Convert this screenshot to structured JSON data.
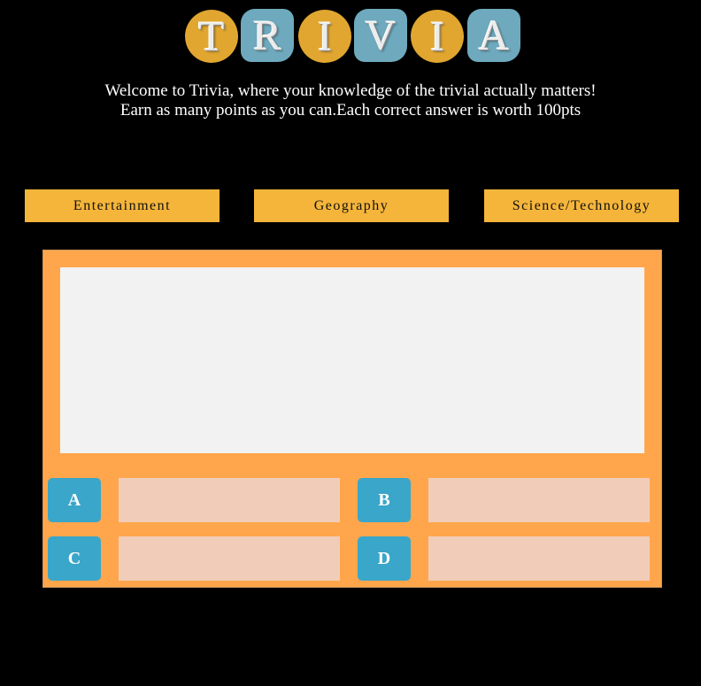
{
  "colors": {
    "background": "#000000",
    "logo_gold": "#e0a630",
    "logo_blue": "#6ea9bd",
    "category_button": "#f5b53a",
    "board": "#ffa64c",
    "question_area": "#f2f2f2",
    "answer_letter": "#3aa6c9",
    "answer_field": "#f1cdb9",
    "welcome_text": "#ffffff"
  },
  "logo": {
    "letters": [
      "T",
      "R",
      "I",
      "V",
      "I",
      "A"
    ]
  },
  "welcome": {
    "line1": "Welcome to Trivia, where your knowledge of the trivial actually matters!",
    "line2": "Earn as many points as you can.Each correct answer is worth 100pts"
  },
  "categories": [
    {
      "label": "Entertainment"
    },
    {
      "label": "Geography"
    },
    {
      "label": "Science/Technology"
    }
  ],
  "board": {
    "question": "",
    "answers": [
      {
        "letter": "A",
        "text": ""
      },
      {
        "letter": "B",
        "text": ""
      },
      {
        "letter": "C",
        "text": ""
      },
      {
        "letter": "D",
        "text": ""
      }
    ]
  }
}
